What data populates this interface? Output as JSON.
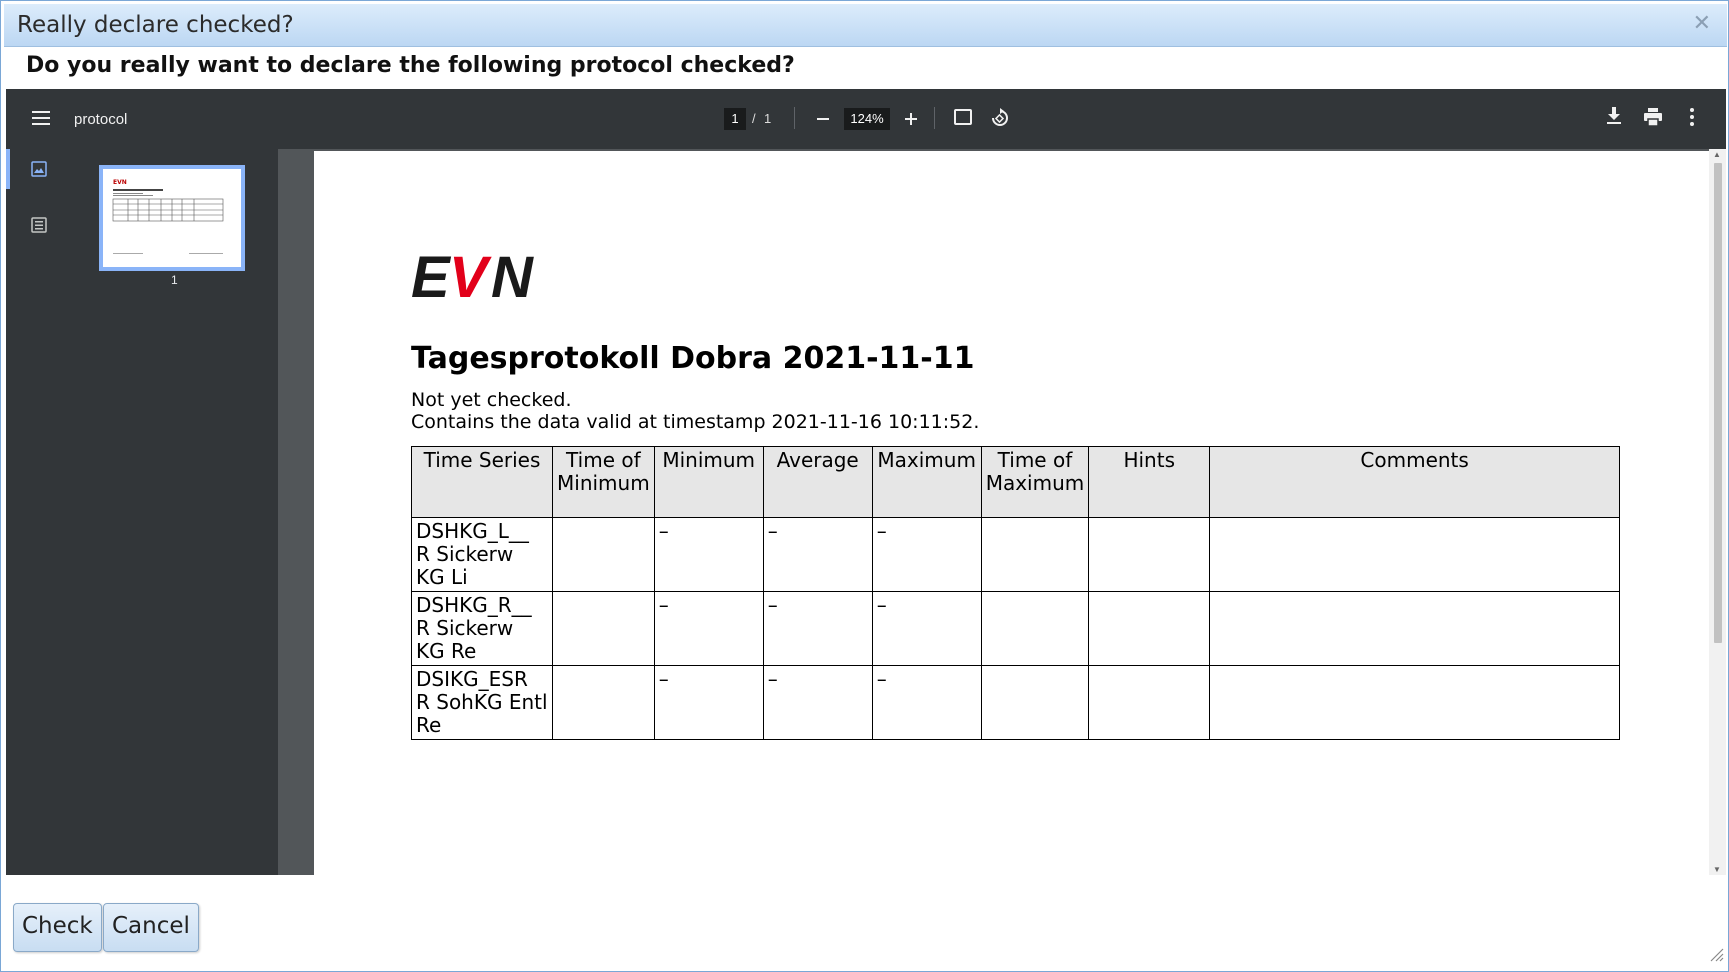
{
  "dialog": {
    "title": "Really declare checked?",
    "question": "Do you really want to declare the following protocol checked?",
    "buttons": {
      "check": "Check",
      "cancel": "Cancel"
    }
  },
  "viewer": {
    "doc_title": "protocol",
    "page_current": "1",
    "page_separator": "/",
    "page_total": "1",
    "zoom": "124%",
    "thumbnail_label": "1",
    "colors": {
      "toolbar": "#323639",
      "accent": "#8ab4f8",
      "background": "#525659"
    }
  },
  "document": {
    "logo": "EVN",
    "heading": "Tagesprotokoll Dobra 2021-11-11",
    "status": "Not yet checked.",
    "valid_at": "Contains the data valid at timestamp 2021-11-16 10:11:52.",
    "columns": [
      "Time Series",
      "Time of Minimum",
      "Minimum",
      "Average",
      "Maximum",
      "Time of Maximum",
      "Hints",
      "Comments"
    ],
    "rows": [
      {
        "series": "DSHKG_L__ R Sickerw KG Li",
        "time_min": "",
        "min": "–",
        "avg": "–",
        "max": "–",
        "time_max": "",
        "hints": "",
        "comments": ""
      },
      {
        "series": "DSHKG_R__ R Sickerw KG Re",
        "time_min": "",
        "min": "–",
        "avg": "–",
        "max": "–",
        "time_max": "",
        "hints": "",
        "comments": ""
      },
      {
        "series": "DSIKG_ESR R SohKG Entl Re",
        "time_min": "",
        "min": "–",
        "avg": "–",
        "max": "–",
        "time_max": "",
        "hints": "",
        "comments": ""
      }
    ]
  }
}
